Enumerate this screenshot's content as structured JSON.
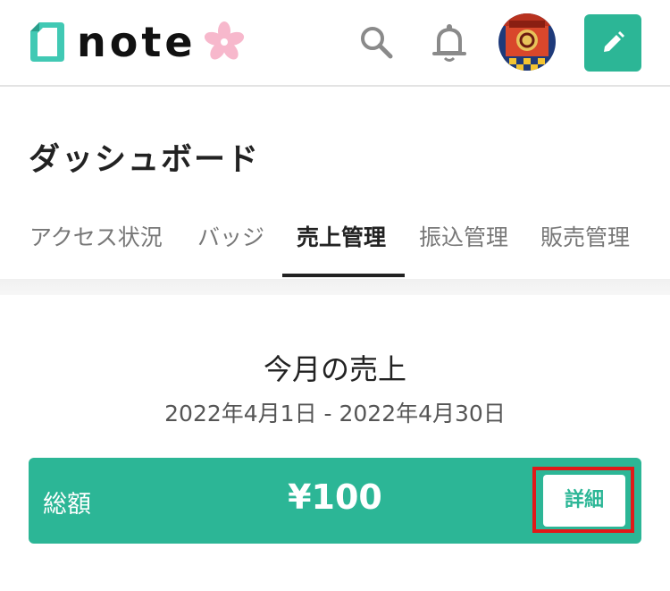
{
  "header": {
    "logo_text": "note",
    "icons": {
      "logo": "note-logo-icon",
      "sakura": "sakura-icon",
      "search": "search-icon",
      "bell": "bell-icon",
      "avatar": "user-avatar",
      "post": "pencil-icon"
    },
    "accent_color": "#2cb696"
  },
  "page": {
    "title": "ダッシュボード"
  },
  "tabs": [
    {
      "label": "アクセス状況",
      "active": false
    },
    {
      "label": "バッジ",
      "active": false
    },
    {
      "label": "売上管理",
      "active": true
    },
    {
      "label": "振込管理",
      "active": false
    },
    {
      "label": "販売管理",
      "active": false
    }
  ],
  "sales": {
    "title": "今月の売上",
    "date_range": "2022年4月1日 - 2022年4月30日",
    "total_label": "総額",
    "total_amount": "¥100",
    "detail_button": "詳細",
    "highlight_color": "#e01919"
  }
}
